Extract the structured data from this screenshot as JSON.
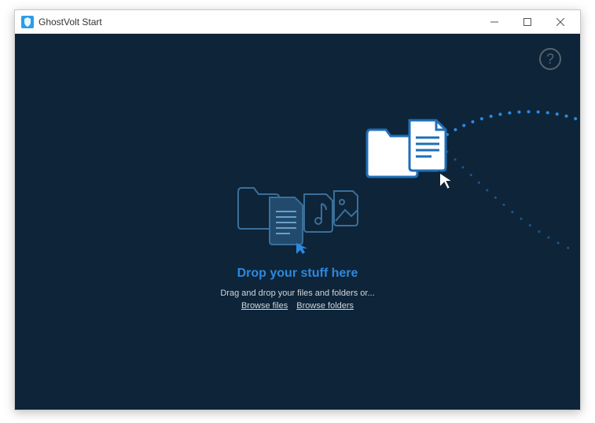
{
  "window": {
    "title": "GhostVolt Start"
  },
  "help": {
    "label": "?"
  },
  "drop": {
    "title": "Drop your stuff here",
    "subtitle": "Drag and drop your files and folders or...",
    "browseFiles": "Browse files",
    "browseFolders": "Browse folders"
  },
  "colors": {
    "background": "#0e2438",
    "accent": "#2d88e0",
    "outline": "#3a6f9a"
  }
}
